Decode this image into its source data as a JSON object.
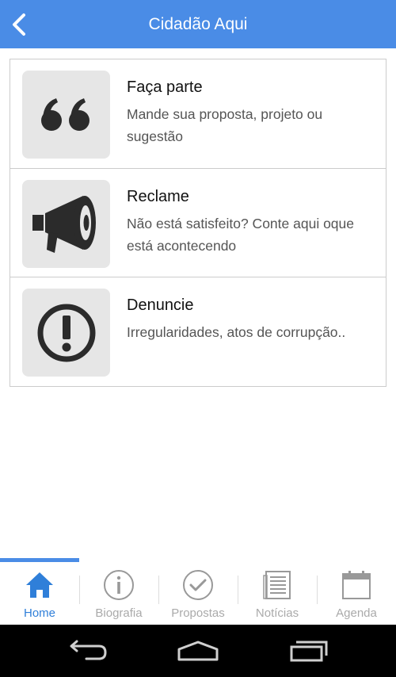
{
  "header": {
    "title": "Cidadão Aqui",
    "back_icon": "chevron-left-icon",
    "background_color": "#4a8ce6"
  },
  "list": {
    "items": [
      {
        "icon": "quote-icon",
        "title": "Faça parte",
        "description": "Mande sua proposta, projeto ou sugestão"
      },
      {
        "icon": "megaphone-icon",
        "title": "Reclame",
        "description": "Não está satisfeito? Conte aqui oque está acontecendo"
      },
      {
        "icon": "exclamation-circle-icon",
        "title": "Denuncie",
        "description": "Irregularidades, atos de corrupção.."
      }
    ]
  },
  "tabbar": {
    "active_tab": "Home",
    "active_color": "#2f7fd9",
    "tabs": [
      {
        "label": "Home",
        "icon": "home-icon"
      },
      {
        "label": "Biografia",
        "icon": "info-circle-icon"
      },
      {
        "label": "Propostas",
        "icon": "check-circle-icon"
      },
      {
        "label": "Notícias",
        "icon": "newspaper-icon"
      },
      {
        "label": "Agenda",
        "icon": "calendar-icon"
      }
    ]
  },
  "system_nav": {
    "buttons": [
      "back-icon",
      "home-icon",
      "recent-apps-icon"
    ]
  }
}
